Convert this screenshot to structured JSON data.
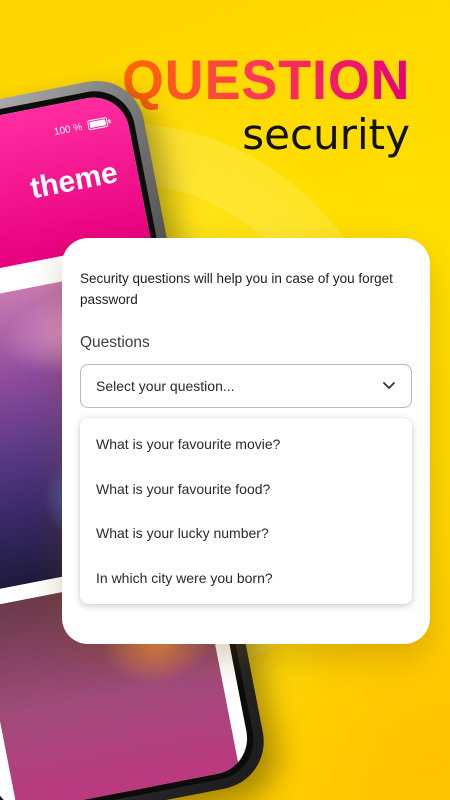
{
  "headline": {
    "title": "QUESTION",
    "subtitle": "security"
  },
  "phone": {
    "status_text": "100 %",
    "screen_title": "theme"
  },
  "security_card": {
    "description": "Security questions will help you in case of you forget password",
    "label": "Questions",
    "select": {
      "placeholder": "Select your question..."
    },
    "options": [
      "What is your favourite movie?",
      "What is your favourite food?",
      "What is your lucky number?",
      "In which city were you born?"
    ]
  },
  "icons": {
    "dropdown": "chevron-down-icon",
    "battery": "battery-icon"
  },
  "colors": {
    "background": "#ffd200",
    "accent_orange": "#ff6a00",
    "accent_pink": "#e5007e",
    "card": "#ffffff"
  }
}
